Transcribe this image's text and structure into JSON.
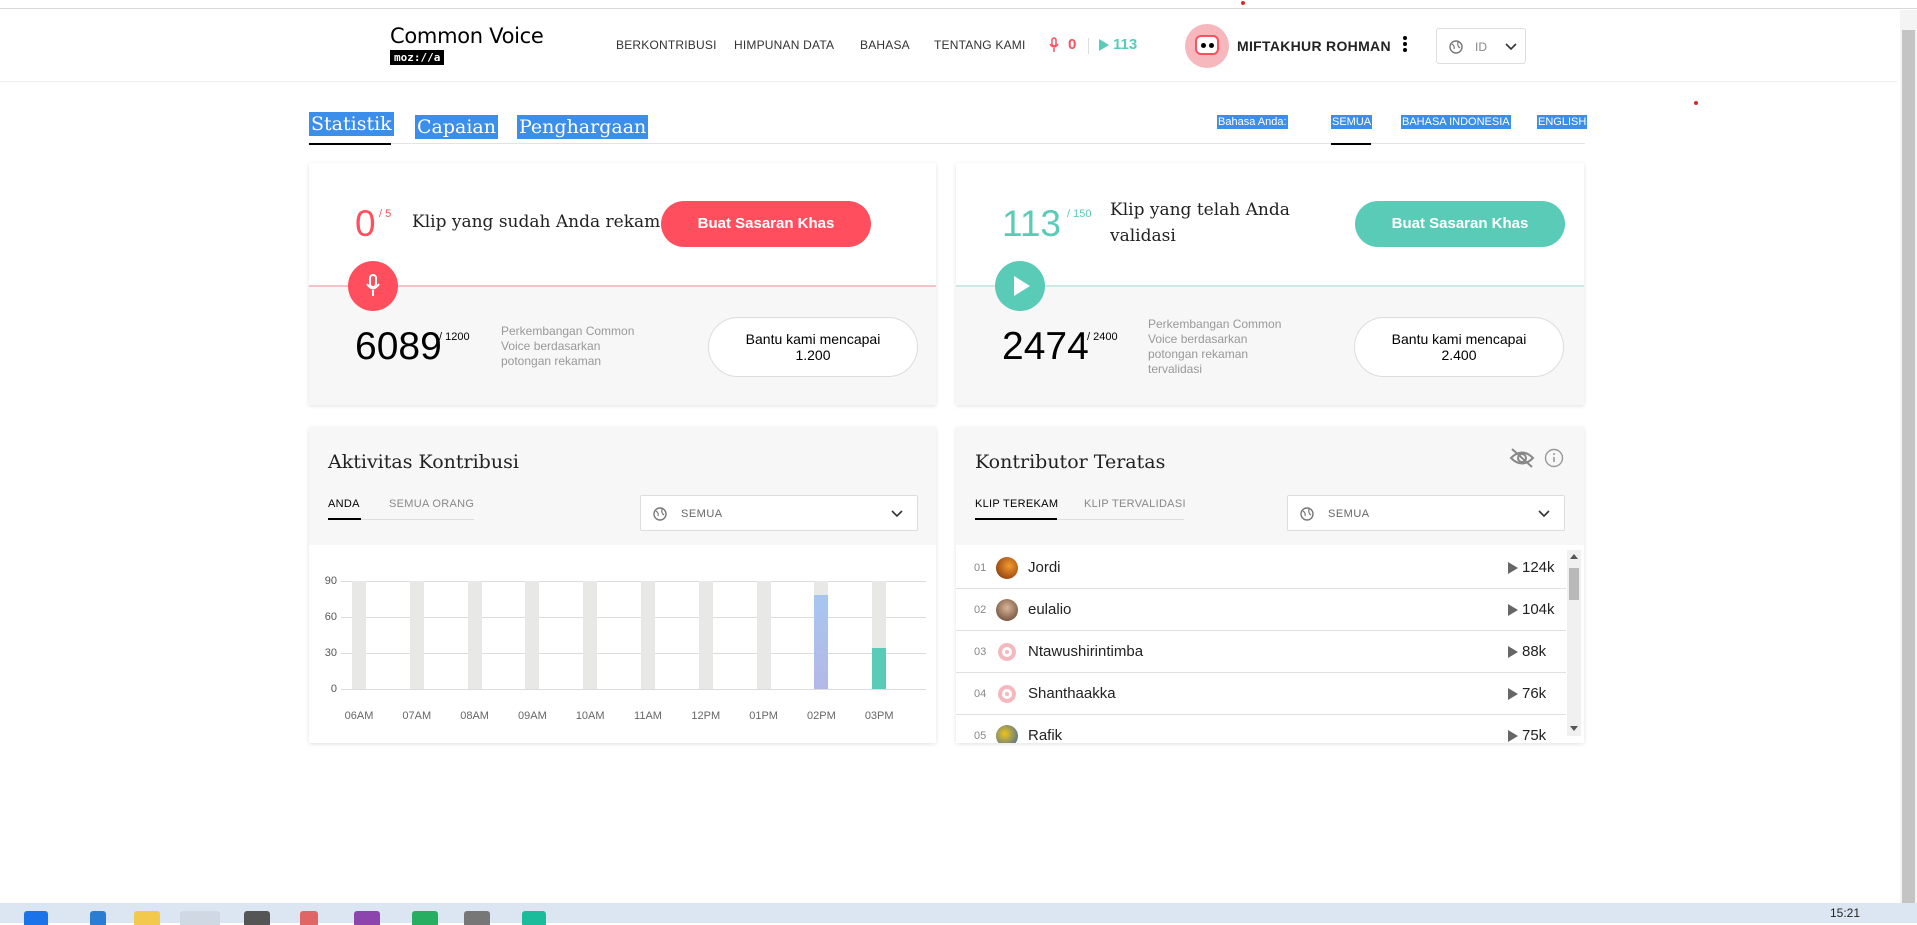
{
  "header": {
    "logo_title": "Common Voice",
    "logo_sub": "moz://a",
    "nav": [
      "BERKONTRIBUSI",
      "HIMPUNAN DATA",
      "BAHASA",
      "TENTANG KAMI"
    ],
    "record_count": "0",
    "validate_count": "113",
    "username": "MIFTAKHUR ROHMAN",
    "language": "ID"
  },
  "tabs": {
    "stats": "Statistik",
    "achievements": "Capaian",
    "awards": "Penghargaan",
    "your_language": "Bahasa Anda:",
    "languages": [
      "SEMUA",
      "BAHASA INDONESIA",
      "ENGLISH"
    ]
  },
  "record_card": {
    "count": "0",
    "goal": "/ 5",
    "label": "Klip yang sudah Anda rekam",
    "button": "Buat Sasaran Khas",
    "total": "6089",
    "total_goal": "/ 1200",
    "desc": "Perkembangan Common Voice berdasarkan potongan rekaman",
    "help_button_line1": "Bantu kami mencapai",
    "help_button_line2": "1.200"
  },
  "validate_card": {
    "count": "113",
    "goal": "/ 150",
    "label_line1": "Klip yang telah Anda",
    "label_line2": "validasi",
    "button": "Buat Sasaran Khas",
    "total": "2474",
    "total_goal": "/ 2400",
    "desc": "Perkembangan Common Voice berdasarkan potongan rekaman tervalidasi",
    "help_button_line1": "Bantu kami mencapai",
    "help_button_line2": "2.400"
  },
  "activity": {
    "title": "Aktivitas Kontribusi",
    "tabs": [
      "ANDA",
      "SEMUA ORANG"
    ],
    "filter": "SEMUA"
  },
  "chart_data": {
    "type": "bar",
    "title": "",
    "xlabel": "",
    "ylabel": "",
    "ylim": [
      0,
      90
    ],
    "yticks": [
      "90",
      "60",
      "30",
      "0"
    ],
    "categories": [
      "06AM",
      "07AM",
      "08AM",
      "09AM",
      "10AM",
      "11AM",
      "12PM",
      "01PM",
      "02PM",
      "03PM"
    ],
    "series": [
      {
        "values": [
          0,
          0,
          0,
          0,
          0,
          0,
          0,
          0,
          78,
          34
        ]
      }
    ],
    "colors": {
      "bar_background": "#e8e8e6",
      "recorded": "#a7c6ef",
      "validated": "#59cbb7"
    }
  },
  "leaderboard": {
    "title": "Kontributor Teratas",
    "tabs": [
      "KLIP TEREKAM",
      "KLIP TERVALIDASI"
    ],
    "filter": "SEMUA",
    "rows": [
      {
        "rank": "01",
        "name": "Jordi",
        "count": "124k"
      },
      {
        "rank": "02",
        "name": "eulalio",
        "count": "104k"
      },
      {
        "rank": "03",
        "name": "Ntawushirintimba",
        "count": "88k"
      },
      {
        "rank": "04",
        "name": "Shanthaakka",
        "count": "76k"
      },
      {
        "rank": "05",
        "name": "Rafik",
        "count": "75k"
      }
    ]
  },
  "taskbar": {
    "time": "15:21"
  },
  "colors": {
    "accent_record": "#ff4f5e",
    "accent_validate": "#59cbb7",
    "selection": "#3b8ee9"
  }
}
